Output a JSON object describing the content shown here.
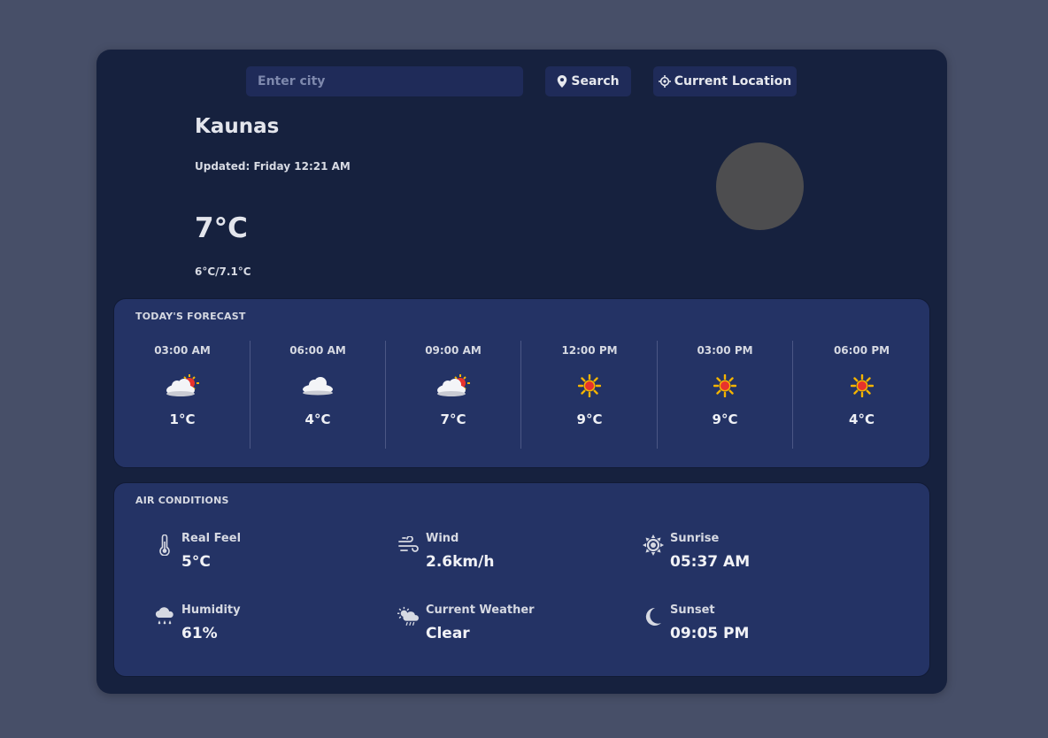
{
  "search": {
    "placeholder": "Enter city",
    "value": "",
    "button_label": "Search",
    "location_label": "Current Location"
  },
  "current": {
    "city": "Kaunas",
    "updated": "Updated: Friday 12:21 AM",
    "temperature": "7°C",
    "min_max": "6°C/7.1°C"
  },
  "forecast": {
    "title": "TODAY'S FORECAST",
    "hours": [
      {
        "time": "03:00 AM",
        "icon": "sun-behind-cloud-icon",
        "temp": "1°C"
      },
      {
        "time": "06:00 AM",
        "icon": "cloud-icon",
        "temp": "4°C"
      },
      {
        "time": "09:00 AM",
        "icon": "sun-behind-cloud-icon",
        "temp": "7°C"
      },
      {
        "time": "12:00 PM",
        "icon": "sun-icon",
        "temp": "9°C"
      },
      {
        "time": "03:00 PM",
        "icon": "sun-icon",
        "temp": "9°C"
      },
      {
        "time": "06:00 PM",
        "icon": "sun-icon",
        "temp": "4°C"
      }
    ]
  },
  "air": {
    "title": "AIR CONDITIONS",
    "real_feel": {
      "label": "Real Feel",
      "value": "5°C",
      "icon": "thermometer-icon"
    },
    "wind": {
      "label": "Wind",
      "value": "2.6km/h",
      "icon": "wind-icon"
    },
    "sunrise": {
      "label": "Sunrise",
      "value": "05:37 AM",
      "icon": "sun-icon"
    },
    "humidity": {
      "label": "Humidity",
      "value": "61%",
      "icon": "rain-cloud-icon"
    },
    "current_weather": {
      "label": "Current Weather",
      "value": "Clear",
      "icon": "cloud-sun-rain-icon"
    },
    "sunset": {
      "label": "Sunset",
      "value": "09:05 PM",
      "icon": "moon-icon"
    }
  },
  "colors": {
    "background": "#474f68",
    "card": "#16213e",
    "panel": "#243365",
    "button": "#1f2b59"
  }
}
